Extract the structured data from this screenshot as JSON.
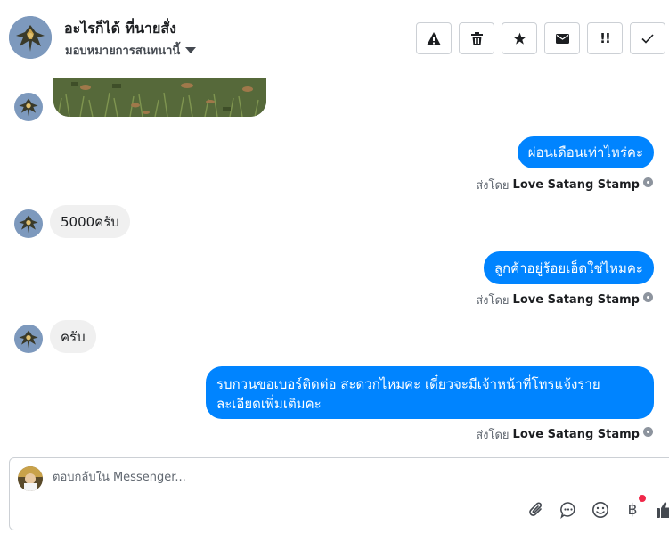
{
  "header": {
    "customer_name": "อะไรก็ได้ ที่นายสั่ง",
    "assign_label": "มอบหมายการสนทนานี้"
  },
  "toolbar": {
    "buttons": [
      {
        "name": "spam",
        "icon": "warning-icon"
      },
      {
        "name": "delete",
        "icon": "trash-icon"
      },
      {
        "name": "star",
        "icon": "star-icon"
      },
      {
        "name": "unread",
        "icon": "envelope-icon"
      },
      {
        "name": "follow-up",
        "icon": "exclamation-icon",
        "label": "!!"
      },
      {
        "name": "done",
        "icon": "checkmark-icon"
      }
    ]
  },
  "messages": [
    {
      "direction": "in",
      "type": "photo",
      "description": ""
    },
    {
      "direction": "out",
      "text": "ผ่อนเดือนเท่าไหร่คะ",
      "sent_by_prefix": "ส่งโดย",
      "sent_by": "Love Satang Stamp"
    },
    {
      "direction": "in",
      "text": "5000ครับ"
    },
    {
      "direction": "out",
      "text": "ลูกค้าอยู่ร้อยเอ็ดใช่ไหมคะ",
      "sent_by_prefix": "ส่งโดย",
      "sent_by": "Love Satang Stamp"
    },
    {
      "direction": "in",
      "text": "ครับ"
    },
    {
      "direction": "out",
      "text_line1": "รบกวนขอเบอร์ติดต่อ สะดวกไหมคะ เดี๋ยวจะมีเจ้าหน้าที่โทรแจ้งราย",
      "text_line2": "ละเอียดเพิ่มเติมคะ",
      "sent_by_prefix": "ส่งโดย",
      "sent_by": "Love Satang Stamp"
    }
  ],
  "composer": {
    "placeholder": "ตอบกลับใน Messenger...",
    "value": "",
    "tools": [
      "paperclip-icon",
      "saved-reply-icon",
      "emoji-icon",
      "baht-icon",
      "thumbs-up-icon"
    ],
    "baht_symbol": "฿"
  },
  "colors": {
    "outgoing_bubble": "#0084ff",
    "incoming_bubble": "#f0f0f0",
    "notification_dot": "#f02849"
  }
}
